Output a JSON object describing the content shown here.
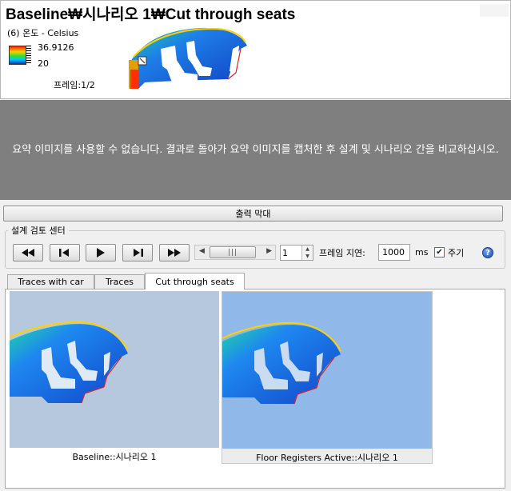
{
  "header": {
    "title": "Baseline₩시나리오 1₩Cut through seats",
    "quantity_label": "(6) 온도 - Celsius",
    "legend_max": "36.9126",
    "legend_min": "20",
    "frame_label": "프레임:1/2"
  },
  "message": "요약 이미지를 사용할 수 없습니다. 결과로 돌아가 요약 이미지를 캡처한 후 설계 및 시나리오 간을 비교하십시오.",
  "output_bar_label": "출력 막대",
  "design_review": {
    "group_label": "설계 검토 센터",
    "frame_value": "1",
    "frame_delay_label": "프레임 지연:",
    "frame_delay_value": "1000",
    "ms_label": "ms",
    "cycle_label": "주기",
    "cycle_checked": "✔",
    "help_glyph": "?"
  },
  "tabs": [
    {
      "label": "Traces with car"
    },
    {
      "label": "Traces"
    },
    {
      "label": "Cut through seats"
    }
  ],
  "cards": [
    {
      "caption": "Baseline::시나리오 1",
      "bg": "#b5c8de"
    },
    {
      "caption": "Floor Registers Active::시나리오 1",
      "bg": "#90b8e8"
    }
  ],
  "icons": {
    "first": "skip-to-start-icon",
    "prev": "step-back-icon",
    "play": "play-icon",
    "next": "step-forward-icon",
    "last": "skip-to-end-icon",
    "help": "help-icon"
  }
}
